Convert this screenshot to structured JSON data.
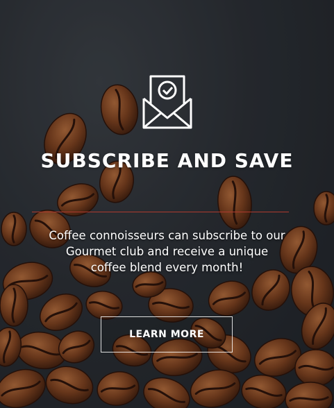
{
  "promo": {
    "title": "SUBSCRIBE AND SAVE",
    "description": "Coffee connoisseurs can subscribe to our Gourmet club and receive a unique coffee blend every month!",
    "button_label": "LEARN MORE",
    "icon": "envelope-check-icon",
    "colors": {
      "accent": "#b03a2e",
      "background": "#2a2e33",
      "text": "#ffffff"
    }
  }
}
